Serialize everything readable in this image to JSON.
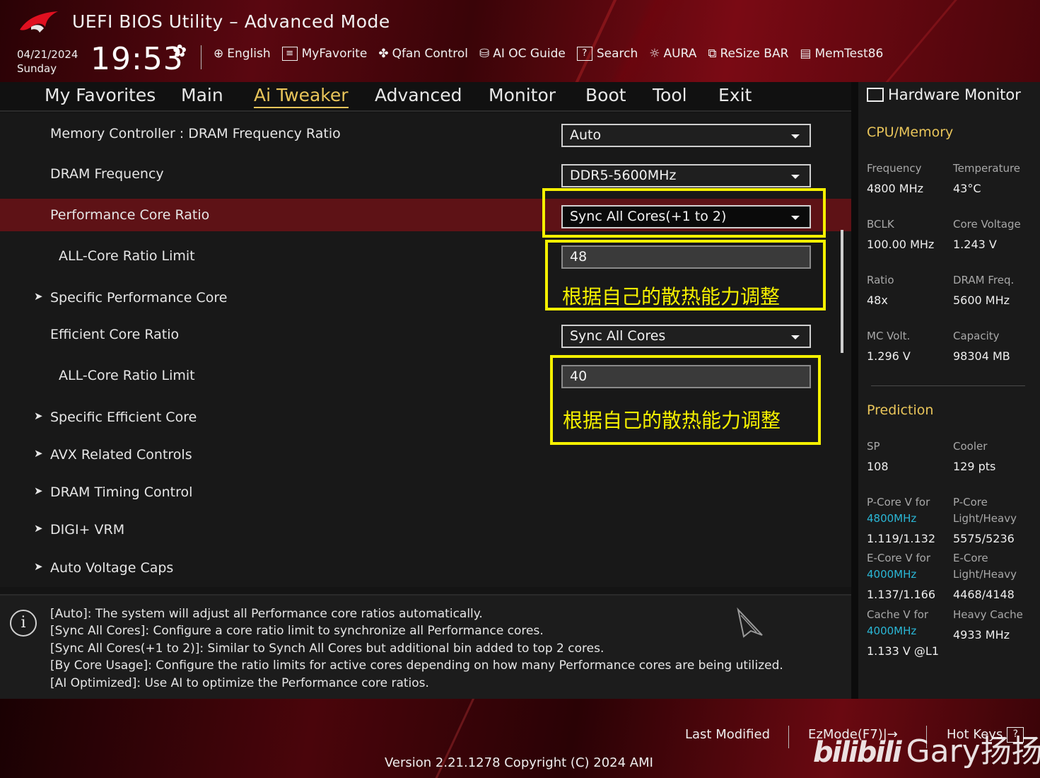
{
  "header": {
    "app_title": "UEFI BIOS Utility – Advanced Mode",
    "date": "04/21/2024",
    "day": "Sunday",
    "time": "19:53",
    "tools": [
      {
        "label": "English",
        "icon": "globe-icon"
      },
      {
        "label": "MyFavorite",
        "icon": "favorite-list-icon"
      },
      {
        "label": "Qfan Control",
        "icon": "fan-icon"
      },
      {
        "label": "AI OC Guide",
        "icon": "ai-chip-icon"
      },
      {
        "label": "Search",
        "icon": "search-question-icon"
      },
      {
        "label": "AURA",
        "icon": "aura-light-icon"
      },
      {
        "label": "ReSize BAR",
        "icon": "resize-bar-icon"
      },
      {
        "label": "MemTest86",
        "icon": "memory-icon"
      }
    ]
  },
  "menu": {
    "items": [
      "My Favorites",
      "Main",
      "Ai Tweaker",
      "Advanced",
      "Monitor",
      "Boot",
      "Tool",
      "Exit"
    ],
    "active": "Ai Tweaker"
  },
  "settings": {
    "mem_ratio": {
      "label": "Memory Controller : DRAM Frequency Ratio",
      "value": "Auto"
    },
    "dram_freq": {
      "label": "DRAM Frequency",
      "value": "DDR5-5600MHz"
    },
    "perf_ratio": {
      "label": "Performance Core Ratio",
      "value": "Sync All Cores(+1 to 2)"
    },
    "perf_limit": {
      "label": "ALL-Core Ratio Limit",
      "value": "48"
    },
    "specific_perf": {
      "label": "Specific Performance Core"
    },
    "eff_ratio": {
      "label": "Efficient Core Ratio",
      "value": "Sync All Cores"
    },
    "eff_limit": {
      "label": "ALL-Core Ratio Limit",
      "value": "40"
    },
    "specific_eff": {
      "label": "Specific Efficient Core"
    },
    "avx": {
      "label": "AVX Related Controls"
    },
    "dram_timing": {
      "label": "DRAM Timing Control"
    },
    "digi": {
      "label": "DIGI+ VRM"
    },
    "auto_voltage": {
      "label": "Auto Voltage Caps"
    }
  },
  "annotations": {
    "note1": "根据自己的散热能力调整",
    "note2": "根据自己的散热能力调整",
    "highlight_color": "#f5f000"
  },
  "help": {
    "lines": [
      "[Auto]: The system will adjust all Performance core ratios automatically.",
      "[Sync All Cores]: Configure a core ratio limit to synchronize all Performance cores.",
      "[Sync All Cores(+1 to 2)]: Similar to Synch All Cores but additional bin added to top 2 cores.",
      "[By Core Usage]: Configure the ratio limits for active cores depending on how many Performance cores are being utilized.",
      "[AI Optimized]: Use AI to optimize the Performance core ratios."
    ]
  },
  "hw_monitor": {
    "title": "Hardware Monitor",
    "cpu_memory": {
      "section": "CPU/Memory",
      "frequency_label": "Frequency",
      "frequency": "4800 MHz",
      "temperature_label": "Temperature",
      "temperature": "43°C",
      "bclk_label": "BCLK",
      "bclk": "100.00 MHz",
      "core_voltage_label": "Core Voltage",
      "core_voltage": "1.243 V",
      "ratio_label": "Ratio",
      "ratio": "48x",
      "dram_freq_label": "DRAM Freq.",
      "dram_freq": "5600 MHz",
      "mc_volt_label": "MC Volt.",
      "mc_volt": "1.296 V",
      "capacity_label": "Capacity",
      "capacity": "98304 MB"
    },
    "prediction": {
      "section": "Prediction",
      "sp_label": "SP",
      "sp": "108",
      "cooler_label": "Cooler",
      "cooler": "129 pts",
      "pcore_v_label": "P-Core V for",
      "pcore_v_freq": "4800MHz",
      "pcore_v": "1.119/1.132",
      "pcore_lh_label1": "P-Core",
      "pcore_lh_label2": "Light/Heavy",
      "pcore_lh": "5575/5236",
      "ecore_v_label": "E-Core V for",
      "ecore_v_freq": "4000MHz",
      "ecore_v": "1.137/1.166",
      "ecore_lh_label1": "E-Core",
      "ecore_lh_label2": "Light/Heavy",
      "ecore_lh": "4468/4148",
      "cache_v_label": "Cache V for",
      "cache_v_freq": "4000MHz",
      "cache_v": "1.133 V @L1",
      "heavy_cache_label": "Heavy Cache",
      "heavy_cache": "4933 MHz"
    }
  },
  "footer": {
    "last_modified": "Last Modified",
    "ezmode": "EzMode(F7)|",
    "hotkeys": "Hot Keys",
    "version": "Version 2.21.1278 Copyright (C) 2024 AMI",
    "watermark_brand": "bilibili",
    "watermark_name": "Gary扬扬"
  }
}
